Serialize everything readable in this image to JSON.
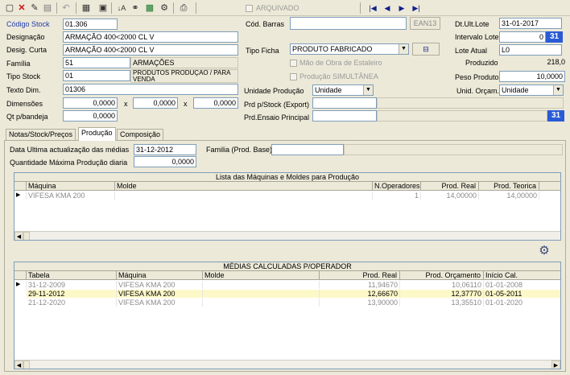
{
  "toolbar": {
    "icons": [
      "new-icon",
      "delete-icon",
      "edit-icon",
      "save-icon",
      "undo-icon",
      "calculator-icon",
      "box-icon",
      "sort-icon",
      "binoculars-icon",
      "excel-icon",
      "print-icon",
      "first-icon",
      "prev-icon",
      "next-icon",
      "last-icon"
    ],
    "arquivado_label": "ARQUIVADO"
  },
  "header": {
    "codigo_stock_label": "Código Stock",
    "codigo_stock_value": "01.306",
    "cod_barras_label": "Cód. Barras",
    "cod_barras_value": "",
    "ean13_label": "EAN13",
    "dt_ult_lote_label": "Dt.Ult.Lote",
    "dt_ult_lote_value": "31-01-2017",
    "designacao_label": "Designação",
    "designacao_value": "ARMAÇÃO 400<2000 CL V",
    "intervalo_lote_label": "Intervalo Lote",
    "intervalo_lote_value": "0",
    "desig_curta_label": "Desig. Curta",
    "desig_curta_value": "ARMAÇÃO 400<2000 CL V",
    "tipo_ficha_label": "Tipo Ficha",
    "tipo_ficha_value": "PRODUTO FABRICADO",
    "lote_atual_label": "Lote Atual",
    "lote_atual_value": "L0",
    "familia_label": "Família",
    "familia_code": "51",
    "familia_name": "ARMAÇÕES",
    "mao_obra_label": "Mão de Obra de Estaleiro",
    "produzido_label": "Produzido",
    "produzido_value": "218,0",
    "tipo_stock_label": "Tipo Stock",
    "tipo_stock_code": "01",
    "tipo_stock_name": "PRODUTOS PRODUÇÃO / PARA VENDA",
    "producao_simultanea_label": "Produção SIMULTÂNEA",
    "peso_produto_label": "Peso Produto",
    "peso_produto_value": "10,0000",
    "texto_dim_label": "Texto Dim.",
    "texto_dim_value": "01306",
    "unidade_producao_label": "Unidade Produção",
    "unidade_producao_value": "Unidade",
    "unid_orcam_label": "Unid. Orçam.",
    "unid_orcam_value": "Unidade",
    "dimensoes_label": "Dimensões",
    "dim1": "0,0000",
    "dim2": "0,0000",
    "dim3": "0,0000",
    "x_sep": "x",
    "prd_stock_label": "Prd p/Stock (Export)",
    "qt_bandeja_label": "Qt p/bandeja",
    "qt_bandeja_value": "0,0000",
    "prd_ensaio_label": "Prd.Ensaio Principal",
    "cal_label": "31"
  },
  "tabs": [
    {
      "label": "Notas/Stock/Preços"
    },
    {
      "label": "Produção"
    },
    {
      "label": "Composição"
    }
  ],
  "producao": {
    "data_ultima_label": "Data Ultima actualização das médias",
    "data_ultima_value": "31-12-2012",
    "familia_prod_label": "Familia (Prod. Base)",
    "qtd_max_label": "Quantidade Máxima Produção diaria",
    "qtd_max_value": "0,0000"
  },
  "maquinas_grid": {
    "title": "Lista das Máquinas e Moldes para Produção",
    "columns": [
      "Máquina",
      "Molde",
      "N.Operadores",
      "Prod. Real",
      "Prod. Teorica"
    ],
    "rows": [
      {
        "maquina": "VIFESA KMA 200",
        "molde": "",
        "n_operadores": "1",
        "prod_real": "14,00000",
        "prod_teorica": "14,00000"
      }
    ]
  },
  "medias_grid": {
    "title": "MÉDIAS CALCULADAS P/OPERADOR",
    "columns": [
      "Tabela",
      "Máquina",
      "Molde",
      "Prod. Real",
      "Prod. Orçamento",
      "Início Cal."
    ],
    "rows": [
      {
        "tabela": "31-12-2009",
        "maquina": "VIFESA KMA 200",
        "molde": "",
        "prod_real": "11,94670",
        "prod_orcamento": "10,06110",
        "inicio": "01-01-2008"
      },
      {
        "tabela": "29-11-2012",
        "maquina": "VIFESA KMA 200",
        "molde": "",
        "prod_real": "12,66670",
        "prod_orcamento": "12,37770",
        "inicio": "01-05-2011"
      },
      {
        "tabela": "21-12-2020",
        "maquina": "VIFESA KMA 200",
        "molde": "",
        "prod_real": "13,90000",
        "prod_orcamento": "13,35510",
        "inicio": "01-01-2020"
      }
    ]
  }
}
